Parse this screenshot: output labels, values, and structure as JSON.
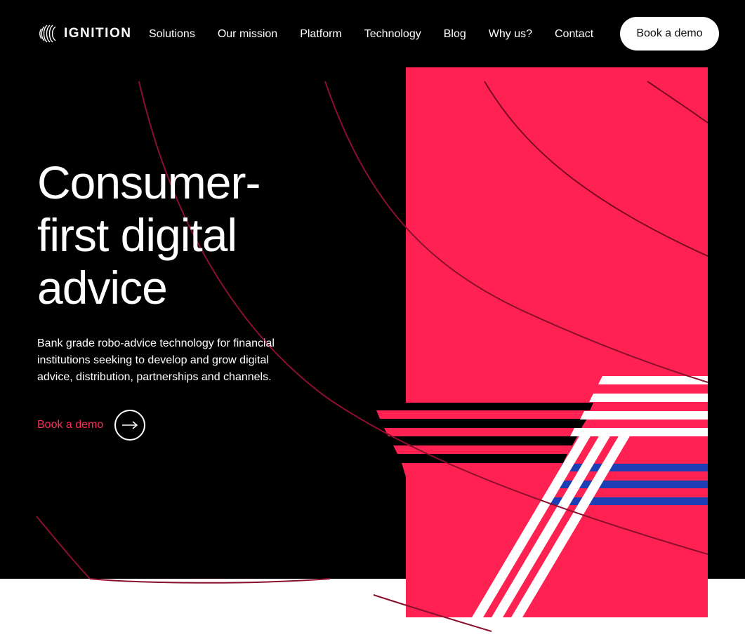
{
  "brand": {
    "name": "IGNITION",
    "accent": "#ff2151",
    "accent_text": "#ff2d55",
    "blue": "#1d3fb6"
  },
  "nav": {
    "items": [
      "Solutions",
      "Our mission",
      "Platform",
      "Technology",
      "Blog",
      "Why us?",
      "Contact"
    ],
    "cta_label": "Book a demo"
  },
  "hero": {
    "title_line1": "Consumer-",
    "title_line2": "first digital",
    "title_line3": "advice",
    "subtitle": "Bank grade robo-advice technology for financial institutions seeking to develop and grow digital advice, distribution, partnerships and channels.",
    "cta_label": "Book a demo",
    "cta_icon": "arrow-right-icon"
  }
}
